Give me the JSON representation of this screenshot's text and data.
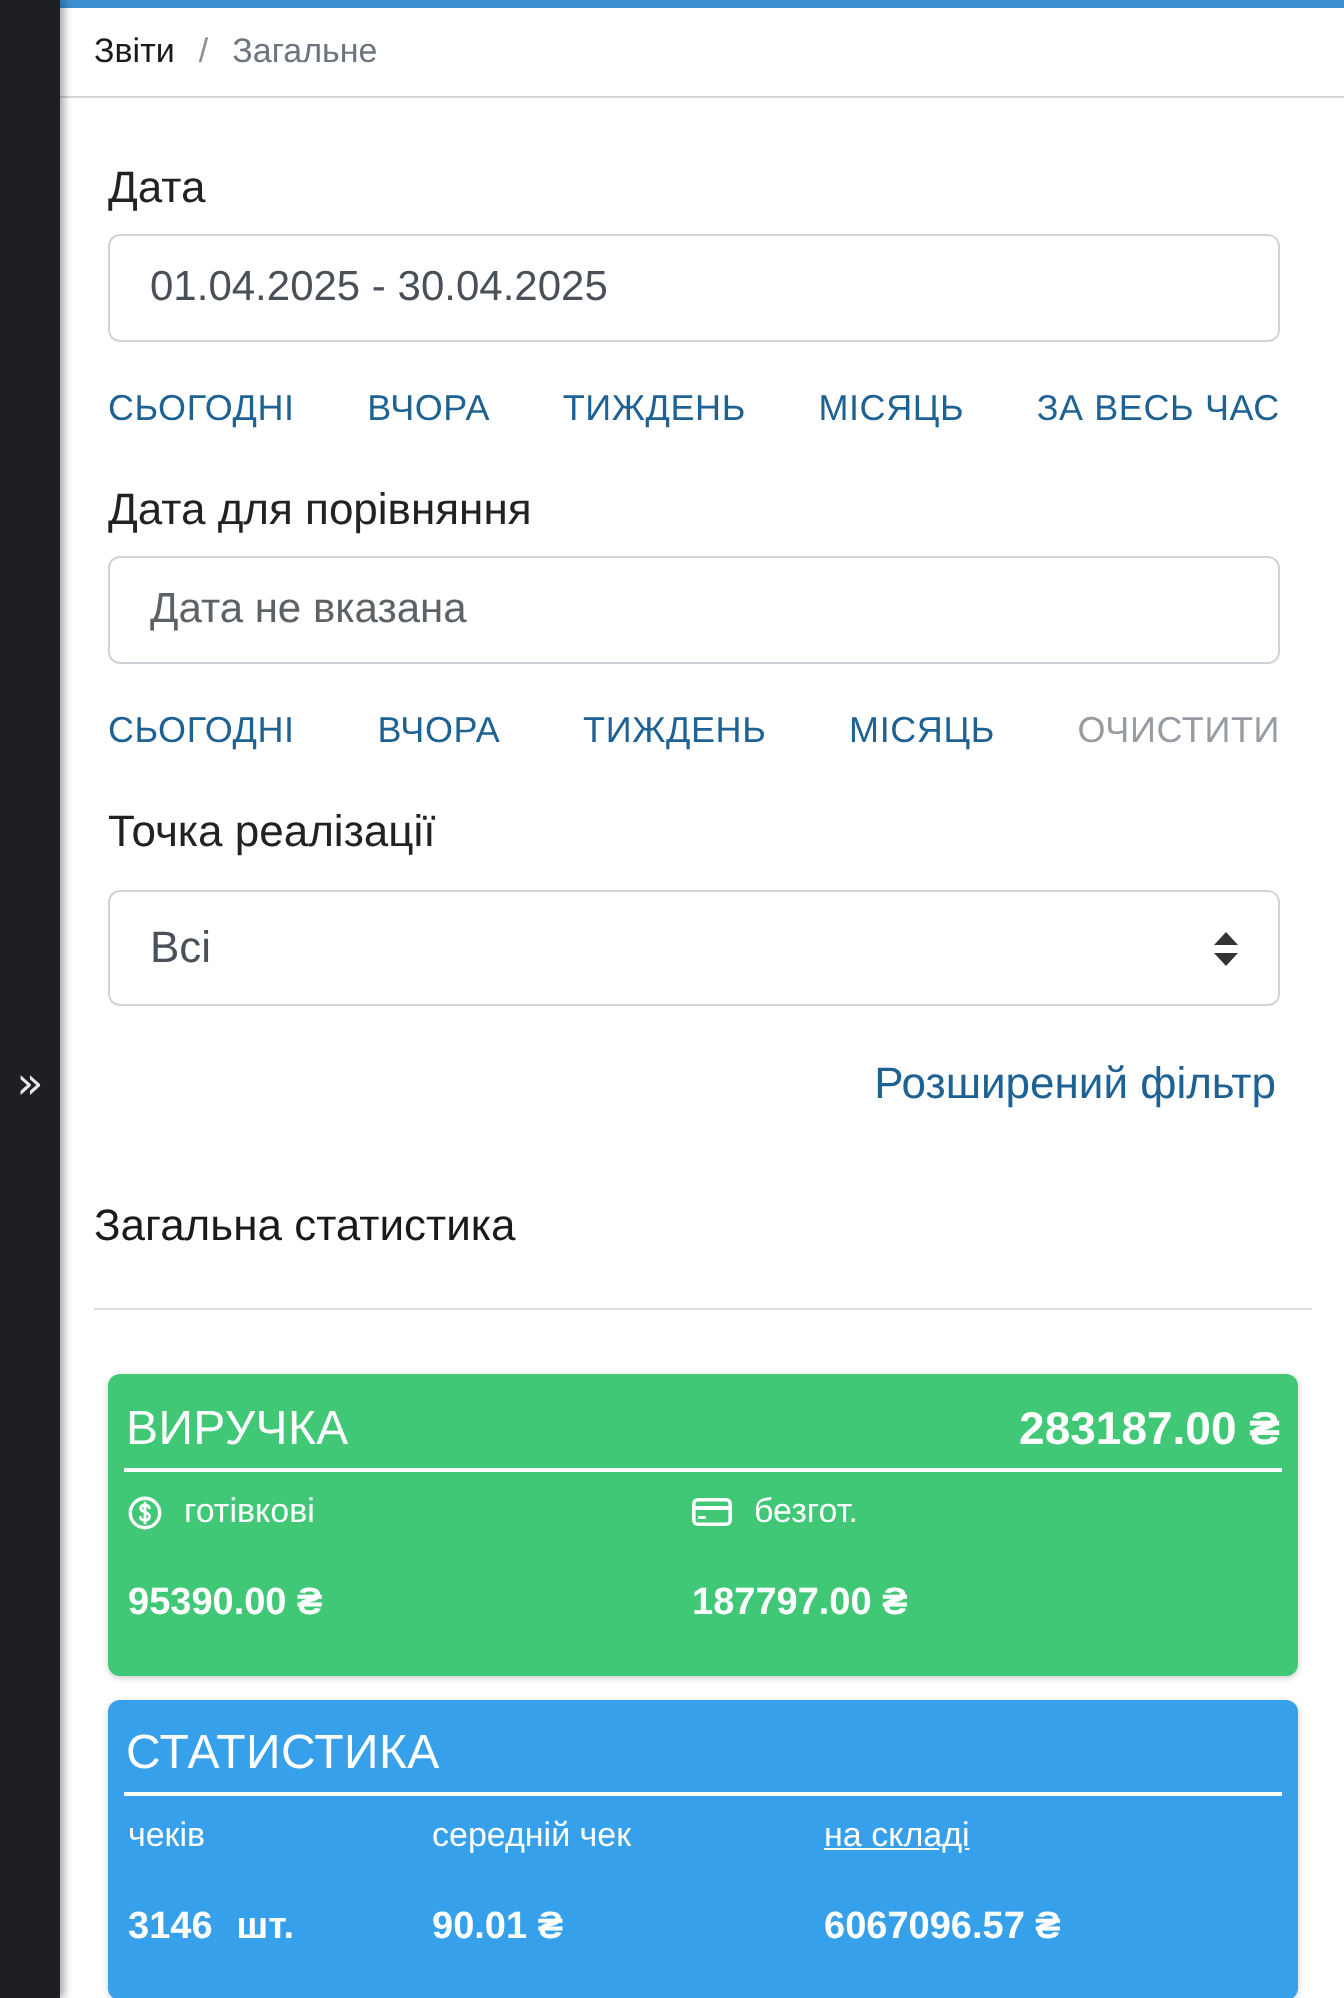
{
  "sidebar": {
    "toggle": "»"
  },
  "breadcrumb": {
    "separator": "/",
    "items": [
      {
        "label": "Звіти",
        "kind": "link"
      },
      {
        "label": "Загальне",
        "kind": "current"
      }
    ]
  },
  "filters": [
    {
      "kind": "date",
      "label": "Дата",
      "value": "01.04.2025 - 30.04.2025",
      "quick": [
        {
          "label": "СЬОГОДНІ",
          "disabled": false
        },
        {
          "label": "ВЧОРА",
          "disabled": false
        },
        {
          "label": "ТИЖДЕНЬ",
          "disabled": false
        },
        {
          "label": "МІСЯЦЬ",
          "disabled": false
        },
        {
          "label": "ЗА ВЕСЬ ЧАС",
          "disabled": false
        }
      ]
    },
    {
      "kind": "date",
      "label": "Дата для порівняння",
      "placeholder": "Дата не вказана",
      "quick": [
        {
          "label": "СЬОГОДНІ",
          "disabled": false
        },
        {
          "label": "ВЧОРА",
          "disabled": false
        },
        {
          "label": "ТИЖДЕНЬ",
          "disabled": false
        },
        {
          "label": "МІСЯЦЬ",
          "disabled": false
        },
        {
          "label": "ОЧИСТИТИ",
          "disabled": true
        }
      ]
    },
    {
      "kind": "select",
      "label": "Точка реалізації",
      "value": "Всі"
    }
  ],
  "advanced_filter": "Розширений фільтр",
  "stats": {
    "title": "Загальна статистика",
    "cards": [
      {
        "title": "ВИРУЧКА",
        "total": "283187.00 ₴",
        "color": "#40c876",
        "items": [
          {
            "kind": "cash",
            "label": "готівкові",
            "value": "95390.00 ₴"
          },
          {
            "kind": "card",
            "label": "безгот.",
            "value": "187797.00 ₴"
          }
        ]
      },
      {
        "title": "СТАТИСТИКА",
        "color": "#36a0ea",
        "items": [
          {
            "kind": "plain",
            "label": "чеків",
            "value": "3146",
            "unit": "шт."
          },
          {
            "kind": "plain",
            "label": "середній чек",
            "value": "90.01 ₴"
          },
          {
            "kind": "link",
            "label": "на складі",
            "value": "6067096.57 ₴"
          }
        ]
      }
    ]
  }
}
